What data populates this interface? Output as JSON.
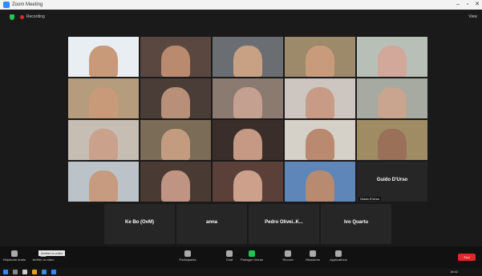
{
  "window": {
    "title": "Zoom Meeting",
    "min": "–",
    "max": "▫",
    "close": "✕"
  },
  "topbar": {
    "recording_label": "Recording",
    "view_label": "View"
  },
  "grid": {
    "rows": [
      [
        {
          "name": "",
          "bg": "#e9eef2",
          "skin": "#c99a7a"
        },
        {
          "name": "",
          "bg": "#5a4840",
          "skin": "#b98a6e"
        },
        {
          "name": "",
          "bg": "#6a6e72",
          "skin": "#c8a084"
        },
        {
          "name": "",
          "bg": "#9c8a6a",
          "skin": "#c79b7c"
        },
        {
          "name": "",
          "bg": "#b8bfb6",
          "skin": "#d1a89a"
        }
      ],
      [
        {
          "name": "",
          "bg": "#b59c7c",
          "skin": "#c99a7a"
        },
        {
          "name": "",
          "bg": "#4a3c36",
          "skin": "#b8907a"
        },
        {
          "name": "",
          "bg": "#8a7a70",
          "skin": "#c4a090"
        },
        {
          "name": "",
          "bg": "#cdc6c0",
          "skin": "#c79b85"
        },
        {
          "name": "",
          "bg": "#a7aaa0",
          "skin": "#c9a48e"
        }
      ],
      [
        {
          "name": "",
          "bg": "#c6bdb3",
          "skin": "#caa28c"
        },
        {
          "name": "",
          "bg": "#7a6c56",
          "skin": "#c39c80"
        },
        {
          "name": "",
          "bg": "#3a2e2a",
          "skin": "#c59984"
        },
        {
          "name": "",
          "bg": "#d5d0c8",
          "skin": "#b98a70"
        },
        {
          "name": "",
          "bg": "#a08c64",
          "skin": "#9a7058"
        }
      ],
      [
        {
          "name": "",
          "bg": "#bcc3c8",
          "skin": "#c79b80"
        },
        {
          "name": "",
          "bg": "#4a3a34",
          "skin": "#c09482"
        },
        {
          "name": "",
          "bg": "#5a4038",
          "skin": "#cca08a"
        },
        {
          "name": "",
          "bg": "#5e86b8",
          "skin": "#b88a70"
        },
        {
          "name": "Guido D'Urso",
          "label": "Guido D'Urso",
          "type": "name"
        }
      ]
    ],
    "bottom": [
      {
        "big": "Ke Bo (OvM)",
        "label": ""
      },
      {
        "big": "anna",
        "label": ""
      },
      {
        "big": "Pedro Olivei..K...",
        "label": ""
      },
      {
        "big": "Ivo Quartu",
        "label": ""
      }
    ]
  },
  "toolbar": {
    "items": [
      {
        "label": "Rejoindre audio"
      },
      {
        "label": "Arrêter la vidéo"
      },
      {
        "label": "Participants",
        "count": "24"
      },
      {
        "label": "Chat"
      },
      {
        "label": "Partager l'écran"
      },
      {
        "label": "Record"
      },
      {
        "label": "Réactions"
      },
      {
        "label": "Applications"
      }
    ],
    "end_label": "End",
    "tooltip": "Arrêter la vidéo"
  },
  "taskbar": {
    "time": "18:42"
  }
}
